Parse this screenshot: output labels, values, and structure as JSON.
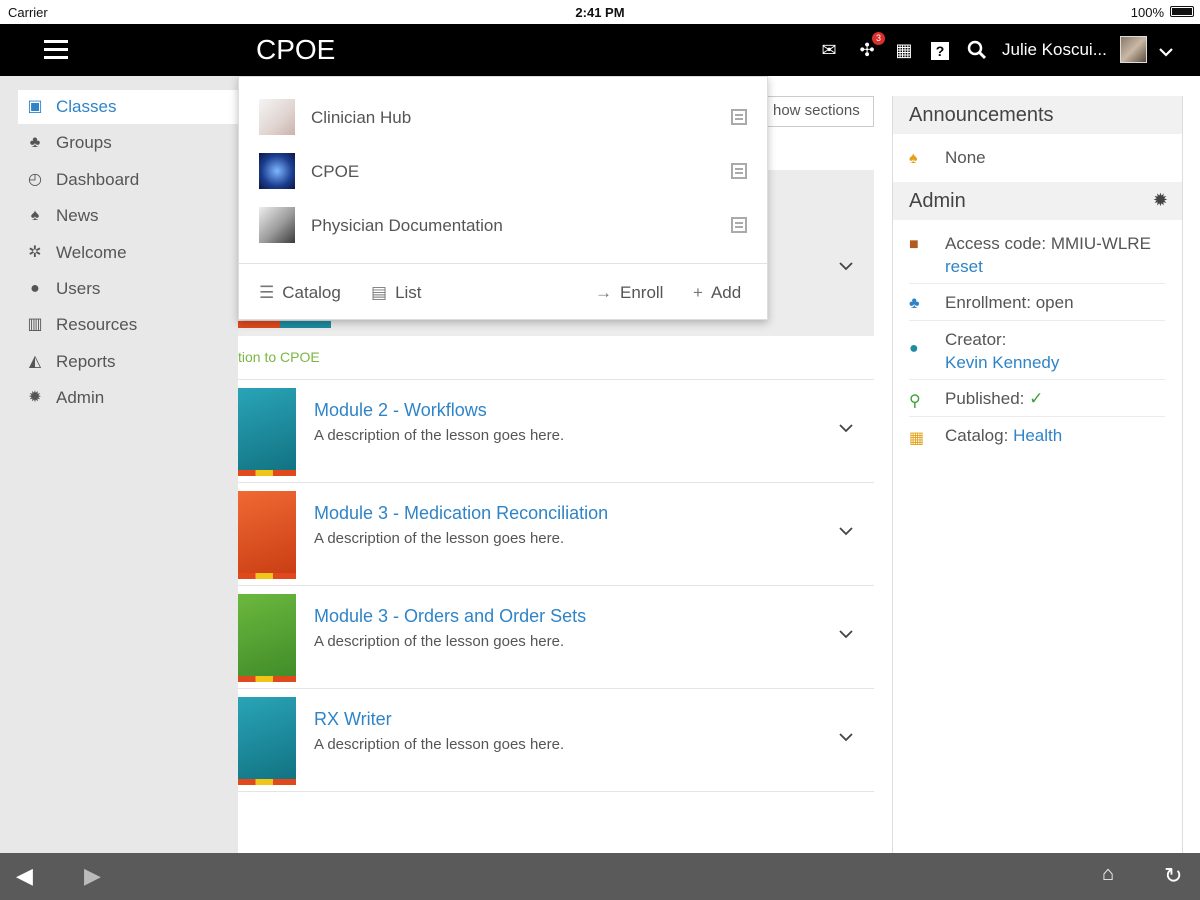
{
  "status": {
    "carrier": "Carrier",
    "time": "2:41 PM",
    "battery": "100%"
  },
  "header": {
    "title": "CPOE",
    "notification_count": "3",
    "user_name": "Julie Koscui..."
  },
  "sidebar": {
    "items": [
      {
        "label": "Classes",
        "icon": "book-icon"
      },
      {
        "label": "Groups",
        "icon": "groups-icon"
      },
      {
        "label": "Dashboard",
        "icon": "dashboard-icon"
      },
      {
        "label": "News",
        "icon": "bell-icon"
      },
      {
        "label": "Welcome",
        "icon": "sun-icon"
      },
      {
        "label": "Users",
        "icon": "user-icon"
      },
      {
        "label": "Resources",
        "icon": "resources-icon"
      },
      {
        "label": "Reports",
        "icon": "chart-icon"
      },
      {
        "label": "Admin",
        "icon": "gear-icon"
      }
    ]
  },
  "dropdown": {
    "items": [
      {
        "label": "Clinician Hub"
      },
      {
        "label": "CPOE"
      },
      {
        "label": "Physician Documentation"
      }
    ],
    "actions": {
      "catalog": "Catalog",
      "list": "List",
      "enroll": "Enroll",
      "add": "Add"
    }
  },
  "main": {
    "show_sections": "how sections",
    "intro": "tion to CPOE",
    "modules": [
      {
        "title": "Module 2 - Workflows",
        "desc": "A description of the lesson goes here.",
        "color": "#1c8ea1"
      },
      {
        "title": "Module 3 - Medication Reconciliation",
        "desc": "A description of the lesson goes here.",
        "color": "#e0491e"
      },
      {
        "title": "Module 3 - Orders and Order Sets",
        "desc": "A description of the lesson goes here.",
        "color": "#55a33a"
      },
      {
        "title": "RX Writer",
        "desc": "A description of the lesson goes here.",
        "color": "#1c8ea1"
      }
    ]
  },
  "right_panel": {
    "announcements_title": "Announcements",
    "announcements_value": "None",
    "admin_title": "Admin",
    "access_code": "Access code: MMIU-WLRE",
    "access_reset": "reset",
    "enrollment": "Enrollment: open",
    "creator_label": "Creator:",
    "creator_name": "Kevin Kennedy",
    "published": "Published:",
    "catalog_label": "Catalog:",
    "catalog_value": "Health"
  },
  "colors": {
    "accent": "#2f84c7",
    "header_bg": "#000000",
    "sidebar_bg": "#e8e8e8",
    "check": "#3aa335"
  }
}
